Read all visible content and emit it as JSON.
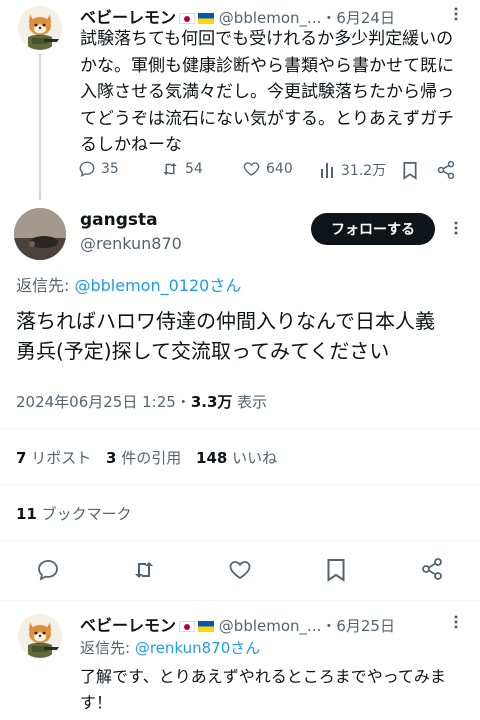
{
  "tweet1": {
    "display_name": "ベビーレモン",
    "handle": "@bblemon_...",
    "date": "・6月24日",
    "text": "試験落ちても何回でも受けれるか多少判定緩いのかな。軍側も健康診断やら書類やら書かせて既に入隊させる気満々だし。今更試験落ちたから帰ってどうぞは流石にない気がする。とりあえずガチるしかねーな",
    "replies": "35",
    "retweets": "54",
    "likes": "640",
    "views": "31.2万"
  },
  "main": {
    "display_name": "gangsta",
    "handle": "@renkun870",
    "follow_label": "フォローする",
    "reply_prefix": "返信先: ",
    "reply_to": "@bblemon_0120さん",
    "text_line1": "落ちればハロワ侍達の仲間入りなんで日本人義",
    "text_line2": "勇兵(予定)探して交流取ってみてください",
    "timestamp": "2024年06月25日 1:25・",
    "views_count": "3.3万",
    "views_label": " 表示",
    "reposts_count": "7",
    "reposts_label": "リポスト",
    "quotes_count": "3",
    "quotes_label": "件の引用",
    "likes_count": "148",
    "likes_label": "いいね",
    "bookmarks_count": "11",
    "bookmarks_label": "ブックマーク"
  },
  "tweet3": {
    "display_name": "ベビーレモン",
    "handle": "@bblemon_...",
    "date": "・6月25日",
    "reply_prefix": "返信先: ",
    "reply_to": "@renkun870さん",
    "text": "了解です、とりあえずやれるところまでやってみます！"
  },
  "colors": {
    "accent": "#1d9bf0",
    "text": "#0f1419",
    "muted": "#536471",
    "divider": "#eff3f4"
  }
}
